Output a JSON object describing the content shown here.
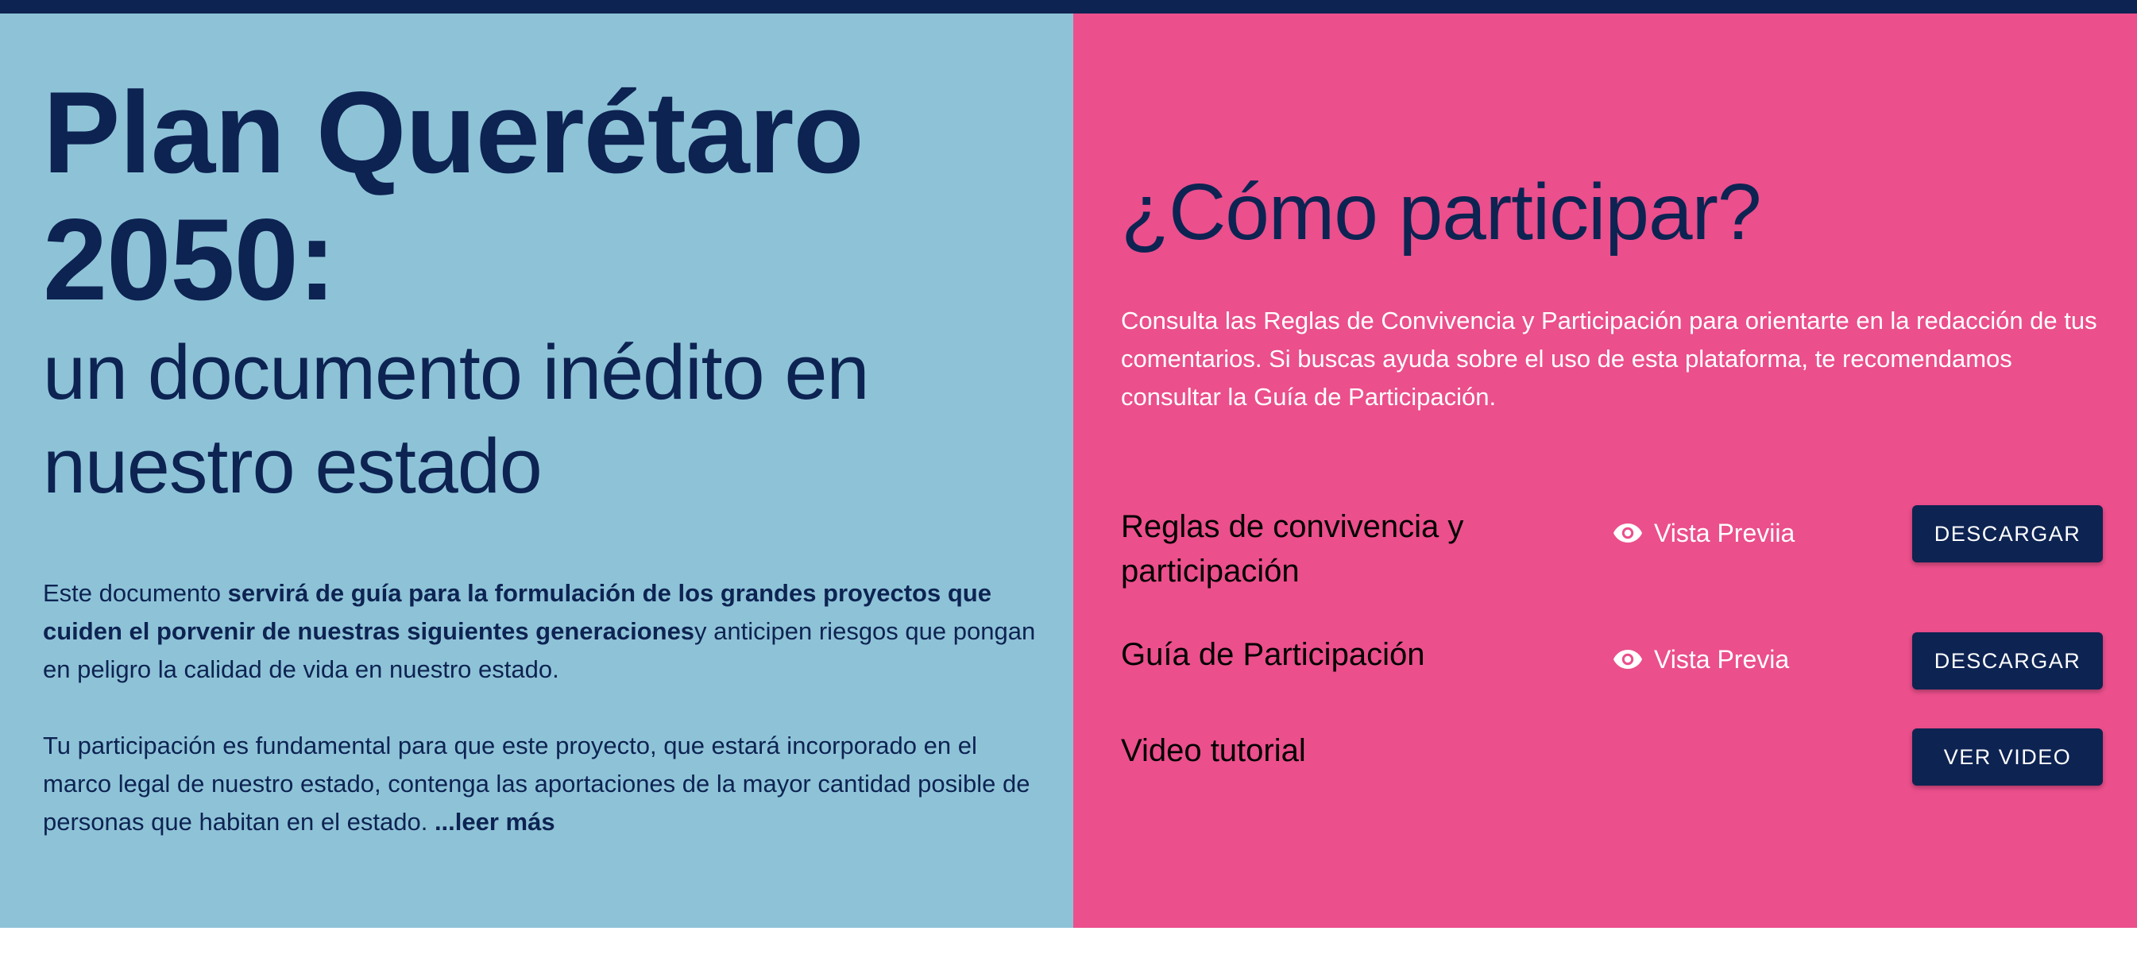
{
  "left": {
    "title": "Plan Querétaro 2050:",
    "subtitle": "un documento inédito en nuestro estado",
    "para1": {
      "prefix": "Este documento ",
      "bold": "servirá de guía para la formulación de los grandes proyectos que cuiden el porvenir de nuestras siguientes generaciones",
      "suffix": "y anticipen riesgos que pongan en peligro la calidad de vida en nuestro estado."
    },
    "para2": {
      "text": "Tu participación es fundamental para que este proyecto, que estará incorporado en el marco legal de nuestro estado, contenga las aportaciones de la mayor cantidad posible de personas que habitan en el estado. ",
      "read_more": "...leer más"
    }
  },
  "right": {
    "title": "¿Cómo participar?",
    "description": "Consulta las Reglas de Convivencia y Participación para orientarte en la redacción de tus comentarios. Si buscas ayuda sobre el uso de esta plataforma, te recomendamos consultar la Guía de Participación.",
    "rows": [
      {
        "label": "Reglas de convivencia y participación",
        "preview_label": "Vista Previia",
        "button_label": "DESCARGAR"
      },
      {
        "label": "Guía de Participación",
        "preview_label": "Vista Previa",
        "button_label": "DESCARGAR"
      },
      {
        "label": "Video tutorial",
        "button_label": "VER VIDEO"
      }
    ]
  },
  "icons": {
    "preview": "eye-icon"
  },
  "colors": {
    "navy": "#0d2352",
    "light_blue": "#8ec3d7",
    "pink": "#eb4f8c",
    "white": "#ffffff"
  }
}
